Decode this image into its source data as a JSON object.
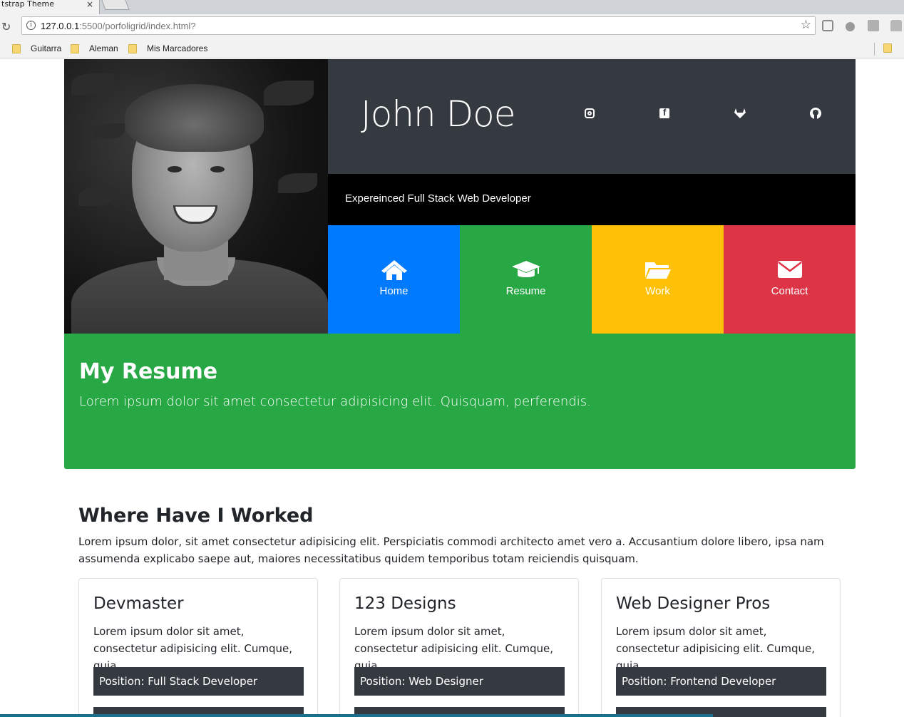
{
  "browser": {
    "tab_title": "tstrap Theme",
    "tab_close": "×",
    "url_host": "127.0.0.1",
    "url_rest": ":5500/porfoligrid/index.html?",
    "bookmarks": [
      "Guitarra",
      "Aleman",
      "Mis Marcadores"
    ]
  },
  "header": {
    "name": "John Doe",
    "tagline": "Expereinced Full Stack Web Developer",
    "social_icons": [
      "instagram-icon",
      "facebook-icon",
      "gitlab-icon",
      "github-icon"
    ]
  },
  "nav": {
    "tiles": [
      {
        "label": "Home",
        "icon": "home-icon",
        "color": "#007bff"
      },
      {
        "label": "Resume",
        "icon": "graduation-cap-icon",
        "color": "#28a745"
      },
      {
        "label": "Work",
        "icon": "folder-open-icon",
        "color": "#ffc107"
      },
      {
        "label": "Contact",
        "icon": "envelope-icon",
        "color": "#dc3545"
      }
    ]
  },
  "jumbotron": {
    "title": "My Resume",
    "subtitle": "Lorem ipsum dolor sit amet consectetur adipisicing elit. Quisquam, perferendis.",
    "color": "#28a745"
  },
  "experience": {
    "title": "Where Have I Worked",
    "intro": "Lorem ipsum dolor, sit amet consectetur adipisicing elit. Perspiciatis commodi architecto amet vero a. Accusantium dolore libero, ipsa nam assumenda explicabo saepe aut, maiores necessitatibus quidem temporibus totam reiciendis quisquam.",
    "cards": [
      {
        "company": "Devmaster",
        "text": "Lorem ipsum dolor sit amet, consectetur adipisicing elit. Cumque, quia.",
        "position": "Position: Full Stack Developer"
      },
      {
        "company": "123 Designs",
        "text": "Lorem ipsum dolor sit amet, consectetur adipisicing elit. Cumque, quia.",
        "position": "Position: Web Designer"
      },
      {
        "company": "Web Designer Pros",
        "text": "Lorem ipsum dolor sit amet, consectetur adipisicing elit. Cumque, quia.",
        "position": "Position: Frontend Developer"
      }
    ]
  }
}
